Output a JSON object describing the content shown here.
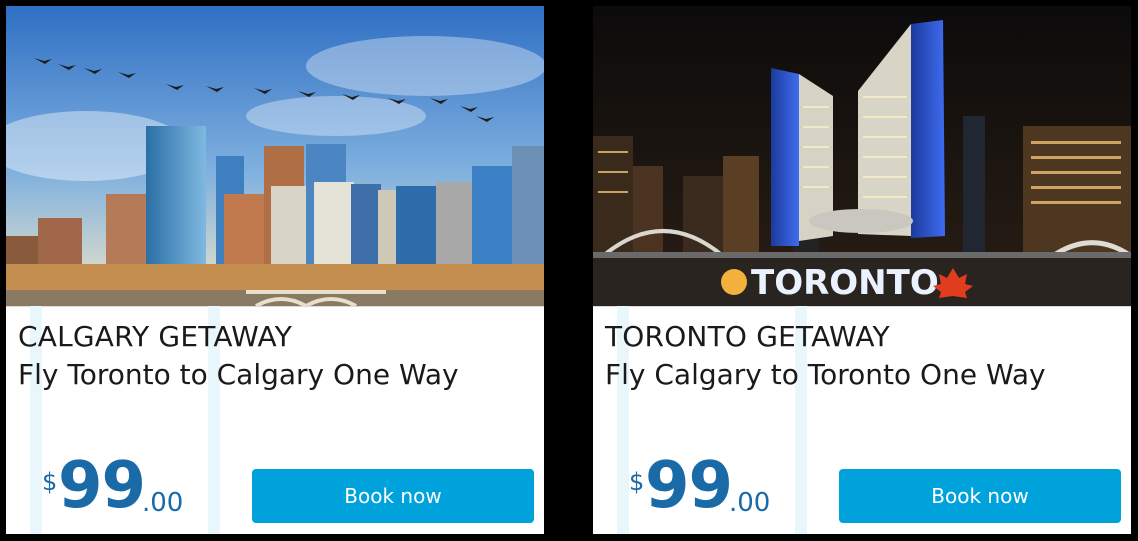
{
  "cards": [
    {
      "title": "CALGARY GETAWAY",
      "subtitle": "Fly Toronto to Calgary One Way",
      "price_symbol": "$",
      "price_whole": "99",
      "price_cents": ".00",
      "button_label": "Book now",
      "accent_color": "#00a2dc",
      "price_color": "#1b6aa8"
    },
    {
      "title": "TORONTO GETAWAY",
      "subtitle": "Fly Calgary to Toronto One Way",
      "price_symbol": "$",
      "price_whole": "99",
      "price_cents": ".00",
      "button_label": "Book now",
      "sign_text": "TORONTO",
      "accent_color": "#00a2dc",
      "price_color": "#1b6aa8"
    }
  ]
}
